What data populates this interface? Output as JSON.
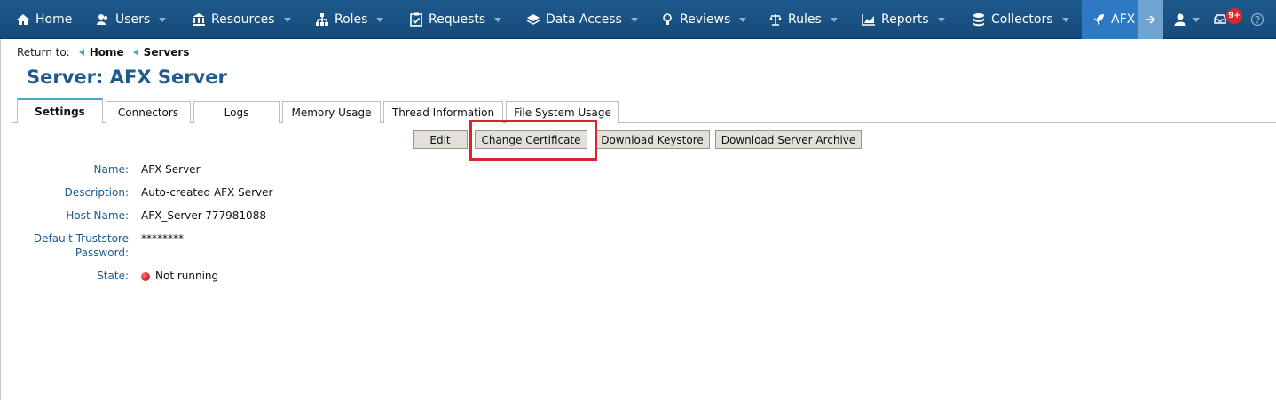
{
  "nav": {
    "home": "Home",
    "users": "Users",
    "resources": "Resources",
    "roles": "Roles",
    "requests": "Requests",
    "data_access": "Data Access",
    "reviews": "Reviews",
    "rules": "Rules",
    "reports": "Reports",
    "collectors": "Collectors",
    "afx": "AFX",
    "notification_badge": "9+"
  },
  "breadcrumb": {
    "label": "Return to:",
    "items": [
      "Home",
      "Servers"
    ]
  },
  "page": {
    "title": "Server: AFX Server"
  },
  "tabs": [
    "Settings",
    "Connectors",
    "Logs",
    "Memory Usage",
    "Thread Information",
    "File System Usage"
  ],
  "buttons": {
    "edit": "Edit",
    "change_certificate": "Change Certificate",
    "download_keystore": "Download Keystore",
    "download_server_archive": "Download Server Archive"
  },
  "details": {
    "name_label": "Name:",
    "name_value": "AFX Server",
    "description_label": "Description:",
    "description_value": "Auto-created AFX Server",
    "host_label": "Host Name:",
    "host_value": "AFX_Server-777981088",
    "truststore_label_1": "Default Truststore",
    "truststore_label_2": "Password:",
    "truststore_value": "********",
    "state_label": "State:",
    "state_value": "Not running"
  },
  "colors": {
    "nav_bg": "#1f5a8e",
    "accent": "#4aa3c8",
    "label": "#1f5a8e",
    "highlight": "#d7262e",
    "state_stopped": "#b30000"
  }
}
